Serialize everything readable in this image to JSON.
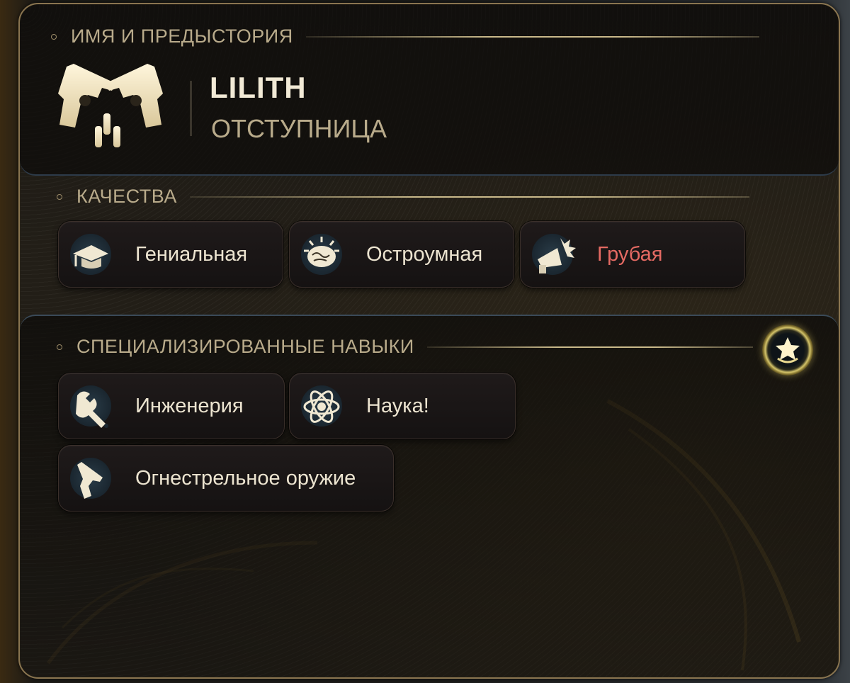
{
  "sections": {
    "identity": {
      "title": "ИМЯ И ПРЕДЫСТОРИЯ"
    },
    "traits": {
      "title": "КАЧЕСТВА"
    },
    "skills": {
      "title": "СПЕЦИАЛИЗИРОВАННЫЕ НАВЫКИ"
    }
  },
  "character": {
    "name": "LILITH",
    "background": "ОТСТУПНИЦА",
    "background_icon": "crossed-revolvers-icon"
  },
  "traits": [
    {
      "label": "Гениальная",
      "icon": "graduation-cap-icon",
      "negative": false
    },
    {
      "label": "Остроумная",
      "icon": "brain-icon",
      "negative": false
    },
    {
      "label": "Грубая",
      "icon": "megaphone-icon",
      "negative": true
    }
  ],
  "skills": [
    {
      "label": "Инженерия",
      "icon": "wrench-icon"
    },
    {
      "label": "Наука!",
      "icon": "atom-icon"
    },
    {
      "label": "Огнестрельное оружие",
      "icon": "pistol-icon"
    }
  ],
  "skills_badge_icon": "star-rank-icon",
  "colors": {
    "accent_gold": "#c9b98a",
    "text_primary": "#ece4d0",
    "text_muted": "#b9ab8b",
    "negative_trait": "#e56a63"
  }
}
